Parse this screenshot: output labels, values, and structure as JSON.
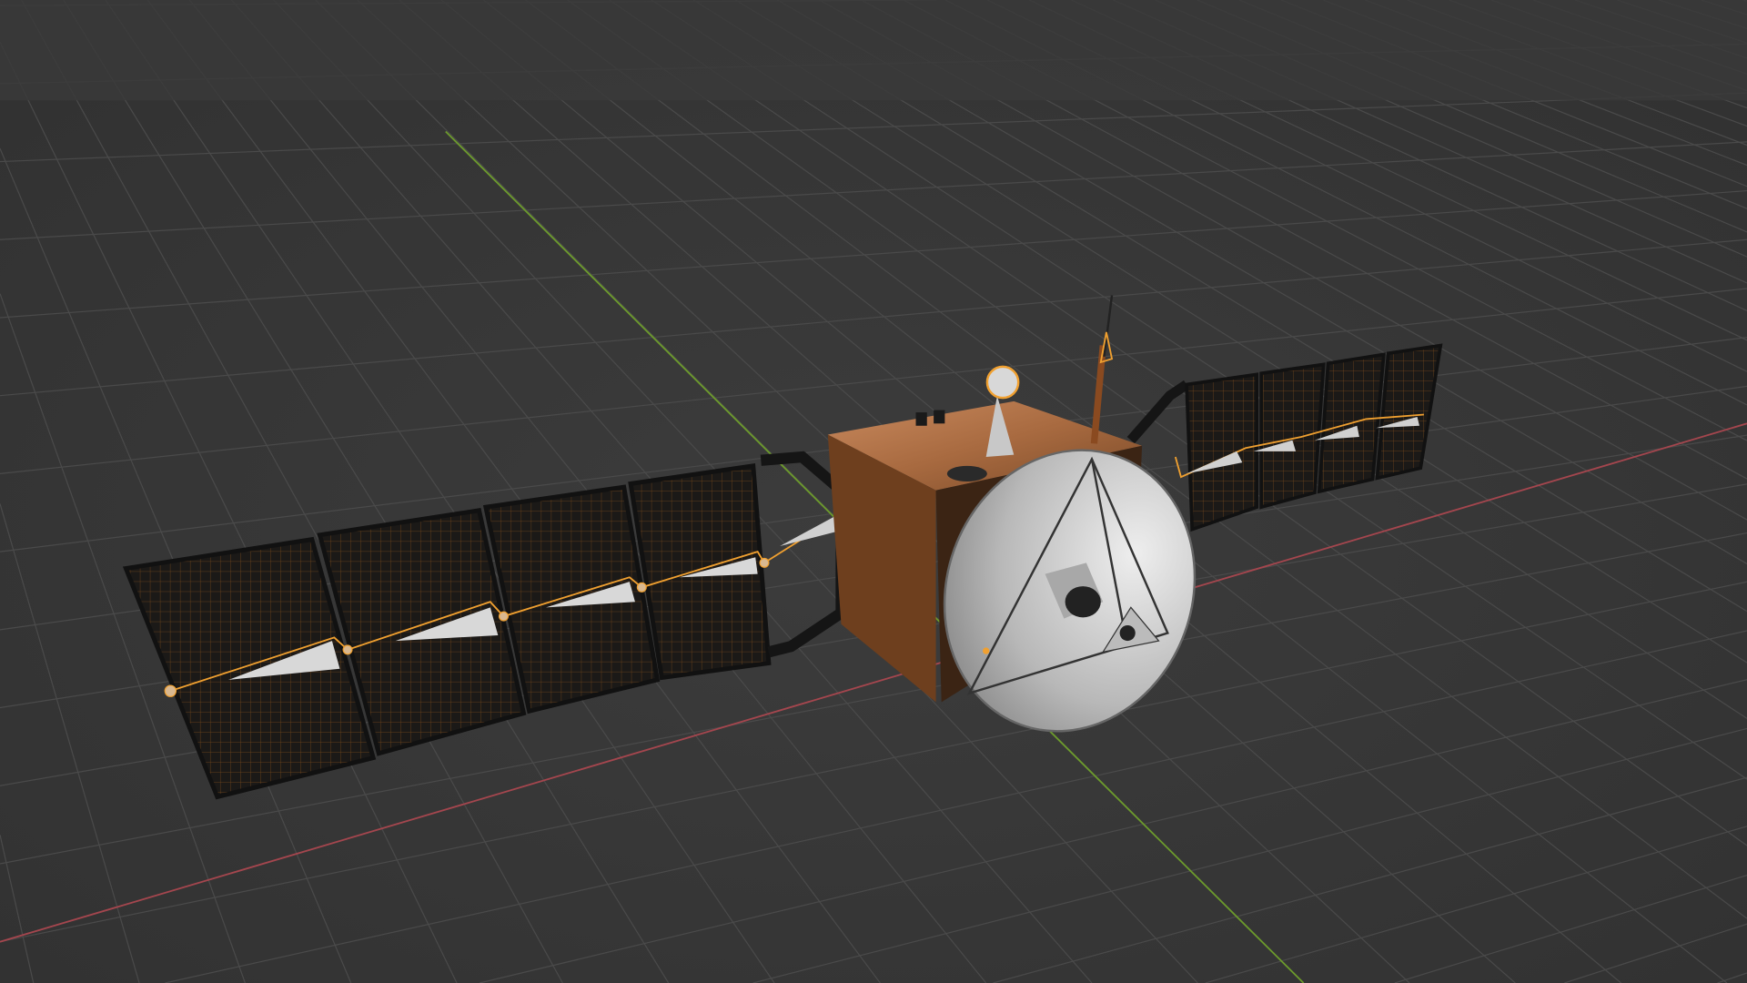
{
  "viewport": {
    "background": "#3a3a3a",
    "grid_color": "#4a4a4a",
    "x_axis_color": "#a4464e",
    "y_axis_color": "#6c9a2c",
    "selection_color": "#f0a030"
  },
  "scene": {
    "object": "satellite",
    "left_panel_count": 4,
    "right_panel_count": 4,
    "body_color": "#9a5a2c",
    "panel_color": "#1c1a18",
    "dish_color": "#cfcfcf"
  },
  "icons": {
    "object": "satellite-model-icon"
  }
}
